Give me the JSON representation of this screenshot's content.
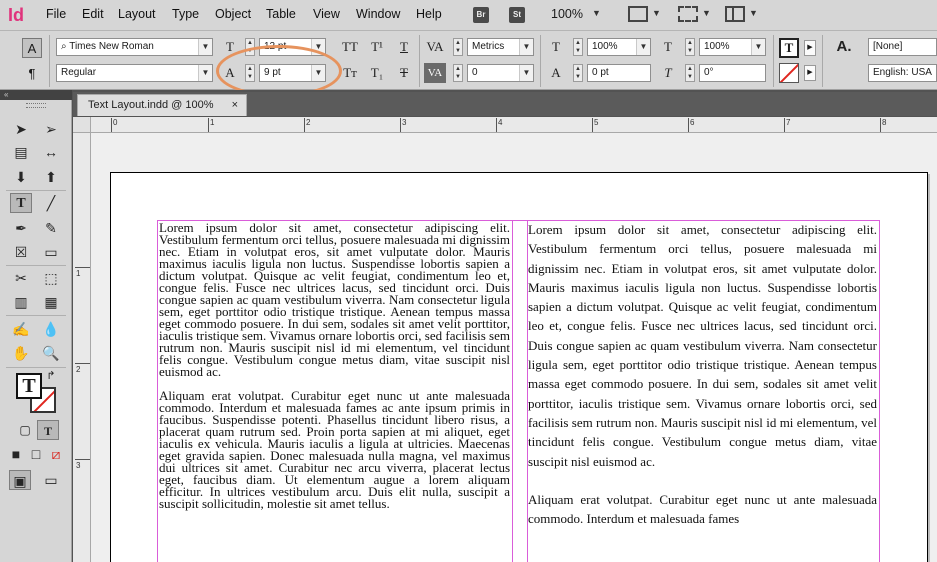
{
  "app": {
    "logo": "Id"
  },
  "menu": [
    "File",
    "Edit",
    "Layout",
    "Type",
    "Object",
    "Table",
    "View",
    "Window",
    "Help"
  ],
  "menubar_extra": {
    "bridge": "Br",
    "stock": "St",
    "zoom": "100%"
  },
  "control": {
    "font_family": "Times New Roman",
    "font_style": "Regular",
    "font_size": "12 pt",
    "leading": "9 pt",
    "kerning": "Metrics",
    "tracking": "0",
    "vertical_scale": "100%",
    "horizontal_scale": "100%",
    "baseline_shift": "0 pt",
    "skew": "0°",
    "char_style": "[None]",
    "language": "English: USA",
    "char_mode_label": "A",
    "para_mode_label": "¶",
    "glyphs": {
      "tt": "TT",
      "t_super": "T¹",
      "t_under": "T",
      "tt_small": "Tт",
      "t_sub": "T₁",
      "t_strike": "T",
      "t_button": "T",
      "a_style": "A.",
      "va": "VA",
      "leading_icon": "A",
      "size_icon": "T",
      "scale_v_icon": "T",
      "scale_h_icon": "T",
      "baseline_icon": "A",
      "skew_icon": "T"
    }
  },
  "tab": {
    "title": "Text Layout.indd @ 100%",
    "close": "×"
  },
  "ruler": {
    "h": [
      "0",
      "1",
      "2",
      "3",
      "4",
      "5",
      "6",
      "7",
      "8"
    ],
    "v": [
      "1",
      "2",
      "3"
    ]
  },
  "toolbar": {
    "grip": "«",
    "tool_glyphs": {
      "selection": "➤",
      "direct": "➢",
      "page": "▤",
      "gap": "↔",
      "content_collector": "⬇",
      "content_placer": "⬆",
      "type": "T",
      "line": "╱",
      "pen": "✒",
      "pencil": "✎",
      "rect_frame": "☒",
      "rect": "▭",
      "scissors": "✂",
      "free_transform": "⬚",
      "gradient": "▥",
      "gradient_feather": "▦",
      "note": "✍",
      "eyedropper": "💧",
      "hand": "✋",
      "zoom": "🔍",
      "fill_swap": "↱",
      "formatting_container": "▢",
      "formatting_text": "T",
      "apply_color": "■",
      "apply_gradient": "□",
      "apply_none": "⧄",
      "normal_view": "▣",
      "screen_mode": "▭"
    },
    "fill_glyph": "T"
  },
  "document": {
    "left_paragraphs": [
      "Lorem ipsum dolor sit amet, consectetur adipiscing elit. Vestibulum fermentum orci tellus, posuere malesuada mi dignissim nec. Etiam in volutpat eros, sit amet vulputate dolor. Mauris maximus iaculis ligula non luctus. Suspendisse lobortis sapien a dictum volutpat. Quisque ac velit feugiat, condimentum leo et, congue felis. Fusce nec ultrices lacus, sed tincidunt orci. Duis congue sapien ac quam vestibulum viverra. Nam consectetur ligula sem, eget porttitor odio tristique tristique. Aenean tempus massa eget commodo posuere. In dui sem, sodales sit amet velit porttitor, iaculis tristique sem. Vivamus ornare lobortis orci, sed facilisis sem rutrum non. Mauris suscipit nisl id mi elementum, vel tincidunt felis congue. Vestibulum congue metus diam, vitae suscipit nisl euismod ac.",
      "Aliquam erat volutpat. Curabitur eget nunc ut ante malesuada commodo. Interdum et malesuada fames ac ante ipsum primis in faucibus. Suspendisse potenti. Phasellus tincidunt libero risus, a placerat quam rutrum sed. Proin porta sapien at mi aliquet, eget iaculis ex vehicula. Mauris iaculis a ligula at ultricies. Maecenas eget gravida sapien. Donec malesuada nulla magna, vel maximus dui ultrices sit amet. Curabitur nec arcu viverra, placerat lectus eget, faucibus diam. Ut elementum augue a lorem aliquam efficitur. In ultrices vestibulum arcu. Duis elit nulla, suscipit a suscipit sollicitudin, molestie sit amet tellus."
    ],
    "right_paragraphs": [
      "Lorem ipsum dolor sit amet, consectetur adipiscing elit. Vestibulum fermentum orci tellus, posuere malesuada mi dignissim nec. Etiam in volutpat eros, sit amet vulputate dolor. Mauris maximus iaculis ligula non luctus. Suspendisse lobortis sapien a dictum volutpat. Quisque ac velit feugiat, condimentum leo et, congue felis. Fusce nec ultrices lacus, sed tincidunt orci. Duis congue sapien ac quam vestibulum viverra. Nam consectetur ligula sem, eget porttitor odio tristique tristique. Aenean tempus massa eget commodo posuere. In dui sem, sodales sit amet velit porttitor, iaculis tristique sem. Vivamus ornare lobortis orci, sed facilisis sem rutrum non. Mauris suscipit nisl id mi elementum, vel tincidunt felis congue. Vestibulum congue metus diam, vitae suscipit nisl euismod ac.",
      "Aliquam erat volutpat. Curabitur eget nunc ut ante malesuada commodo. Interdum et malesuada fames"
    ]
  },
  "colors": {
    "accent_logo": "#e0337c",
    "frame_guide": "#d95dd9",
    "highlight": "#e6935e"
  }
}
